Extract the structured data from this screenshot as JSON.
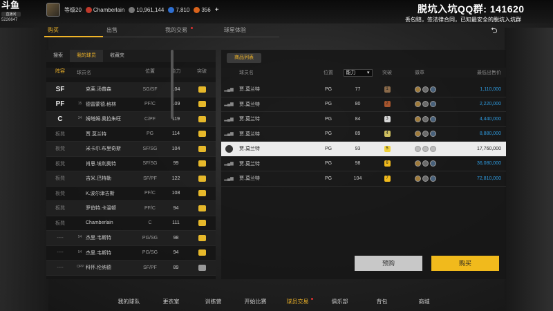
{
  "stream": {
    "platform_logo": "斗鱼",
    "platform_sub": "直播间",
    "room_id": "5226647",
    "promo_title": "脱坑入坑QQ群: 141620",
    "promo_sub": "丢包赔，签法律合同，已知最安全的脱坑入坑群"
  },
  "profile": {
    "level": "等级20",
    "name": "Chamberlain",
    "coins": "10,961,144",
    "diamonds": "7,810",
    "tickets": "356",
    "plus": "+"
  },
  "nav_tabs": [
    {
      "label": "购买",
      "active": true
    },
    {
      "label": "出售",
      "active": false
    },
    {
      "label": "我的交易",
      "active": false,
      "dot": true
    },
    {
      "label": "球星体验",
      "active": false
    }
  ],
  "left_panel": {
    "tabs": [
      "搜索",
      "我的球员",
      "收藏夹"
    ],
    "active_tab": 1,
    "headers": [
      "阵容",
      "球员名",
      "位置",
      "能力",
      "突破"
    ],
    "rows": [
      {
        "slot": "SF",
        "num": "",
        "name": "克莱.汤普森",
        "pos": "SG/SF",
        "ovr": "104",
        "badge": "gold"
      },
      {
        "slot": "PF",
        "num": "15",
        "name": "德雷蒙德.格林",
        "pos": "PF/C",
        "ovr": "109",
        "badge": "gold"
      },
      {
        "slot": "C",
        "num": "34",
        "name": "姆塔姆.奥拉朱旺",
        "pos": "C/PF",
        "ovr": "119",
        "badge": "gold"
      },
      {
        "slot": "板凳",
        "num": "",
        "name": "贾.莫兰特",
        "pos": "PG",
        "ovr": "114",
        "badge": "gold"
      },
      {
        "slot": "板凳",
        "num": "",
        "name": "米卡尔.布里奇斯",
        "pos": "SF/SG",
        "ovr": "104",
        "badge": "gold"
      },
      {
        "slot": "板凳",
        "num": "",
        "name": "肖恩.埃利奥特",
        "pos": "SF/SG",
        "ovr": "99",
        "badge": "gold"
      },
      {
        "slot": "板凳",
        "num": "",
        "name": "吉米.巴特勒",
        "pos": "SF/PF",
        "ovr": "122",
        "badge": "gold"
      },
      {
        "slot": "板凳",
        "num": "",
        "name": "K.波尔津吉斯",
        "pos": "PF/C",
        "ovr": "108",
        "badge": "gold"
      },
      {
        "slot": "板凳",
        "num": "",
        "name": "罗伯特.卡温顿",
        "pos": "PF/C",
        "ovr": "94",
        "badge": "gold"
      },
      {
        "slot": "板凳",
        "num": "",
        "name": "Chamberlain",
        "pos": "C",
        "ovr": "111",
        "badge": "gold"
      },
      {
        "slot": "----",
        "num": "54",
        "name": "杰里.韦斯特",
        "pos": "PG/SG",
        "ovr": "98",
        "badge": "gold"
      },
      {
        "slot": "----",
        "num": "54",
        "name": "杰里.韦斯特",
        "pos": "PG/SG",
        "ovr": "94",
        "badge": "gold"
      },
      {
        "slot": "----",
        "num": "OPP",
        "name": "科怀.伦纳德",
        "pos": "SF/PF",
        "ovr": "89",
        "badge": "grey"
      }
    ]
  },
  "right_panel": {
    "title": "商品列表",
    "headers": [
      "球员名",
      "位置",
      "能力",
      "突破",
      "徽章",
      "最低出售价"
    ],
    "sort_value": "能力",
    "rows": [
      {
        "name": "贾.莫兰特",
        "pos": "PG",
        "ovr": "77",
        "level": "1",
        "price": "1,110,000",
        "selected": false
      },
      {
        "name": "贾.莫兰特",
        "pos": "PG",
        "ovr": "80",
        "level": "2",
        "price": "2,220,000",
        "selected": false
      },
      {
        "name": "贾.莫兰特",
        "pos": "PG",
        "ovr": "84",
        "level": "3",
        "price": "4,440,000",
        "selected": false
      },
      {
        "name": "贾.莫兰特",
        "pos": "PG",
        "ovr": "89",
        "level": "4",
        "price": "8,880,000",
        "selected": false
      },
      {
        "name": "贾.莫兰特",
        "pos": "PG",
        "ovr": "93",
        "level": "5",
        "price": "17,760,000",
        "selected": true
      },
      {
        "name": "贾.莫兰特",
        "pos": "PG",
        "ovr": "98",
        "level": "6",
        "price": "36,080,000",
        "selected": false
      },
      {
        "name": "贾.莫兰特",
        "pos": "PG",
        "ovr": "104",
        "level": "7",
        "price": "72,810,000",
        "selected": false
      }
    ],
    "preorder_label": "预购",
    "buy_label": "购买"
  },
  "bottom_nav": [
    {
      "label": "我的球队"
    },
    {
      "label": "更衣室"
    },
    {
      "label": "训练营"
    },
    {
      "label": "开始比赛"
    },
    {
      "label": "球员交易",
      "active": true,
      "dot": true
    },
    {
      "label": "俱乐部"
    },
    {
      "label": "背包"
    },
    {
      "label": "商城"
    }
  ],
  "colors": {
    "accent": "#f0b428",
    "price_blue": "#2e9be0",
    "level_colors": [
      "#8a6a4a",
      "#a8552d",
      "#d8d8d8",
      "#d0c060",
      "#f1d23a",
      "#f1ba1c",
      "#f1ba1c"
    ]
  }
}
